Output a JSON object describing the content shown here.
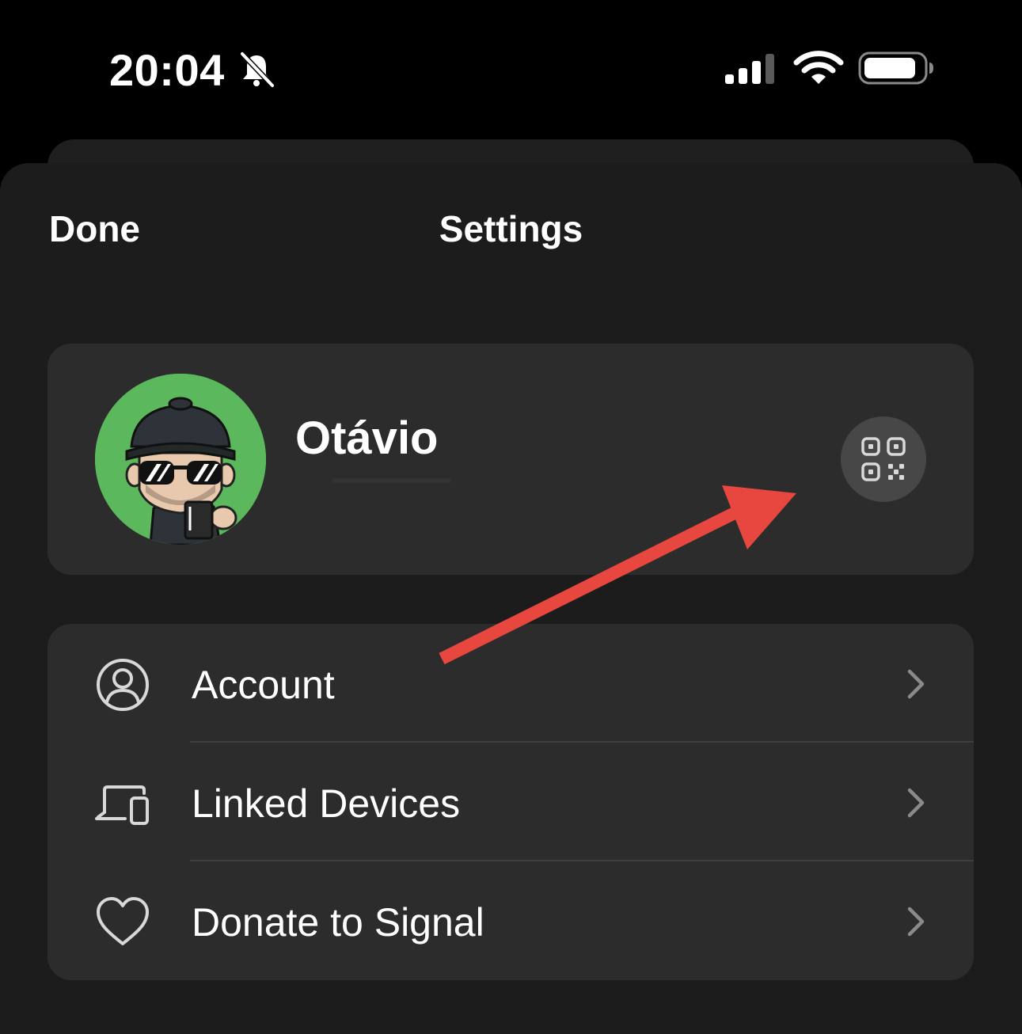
{
  "status_bar": {
    "time": "20:04",
    "icons": [
      "bell-slash-icon",
      "cellular-signal-icon",
      "wifi-icon",
      "battery-icon"
    ]
  },
  "header": {
    "done_label": "Done",
    "title": "Settings"
  },
  "profile": {
    "name": "Otávio",
    "avatar_background": "#5cb85c",
    "qr_icon": "qr-code-icon"
  },
  "menu": {
    "items": [
      {
        "label": "Account",
        "icon": "person-circle-icon"
      },
      {
        "label": "Linked Devices",
        "icon": "devices-icon"
      },
      {
        "label": "Donate to Signal",
        "icon": "heart-icon"
      }
    ]
  },
  "colors": {
    "background": "#000000",
    "sheet": "#1c1c1c",
    "card": "#2c2c2c",
    "annotation_arrow": "#e8473f"
  }
}
